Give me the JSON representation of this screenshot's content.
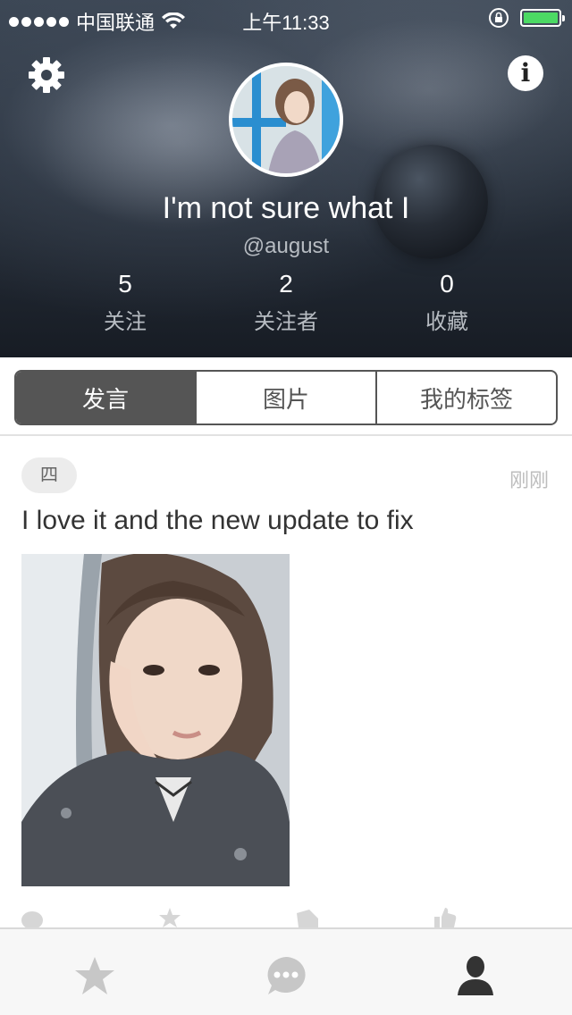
{
  "status_bar": {
    "carrier": "中国联通",
    "time": "上午11:33"
  },
  "profile": {
    "name": "I'm not sure what I",
    "handle": "@august",
    "stats": [
      {
        "value": "5",
        "label": "关注"
      },
      {
        "value": "2",
        "label": "关注者"
      },
      {
        "value": "0",
        "label": "收藏"
      }
    ]
  },
  "header_buttons": {
    "info_glyph": "i"
  },
  "tabs": [
    {
      "label": "发言",
      "active": true
    },
    {
      "label": "图片",
      "active": false
    },
    {
      "label": "我的标签",
      "active": false
    }
  ],
  "post": {
    "badge": "四",
    "time": "刚刚",
    "text": "I love it and the new update to fix"
  },
  "icons": {
    "settings": "gear-icon",
    "info": "info-icon",
    "tabbar": [
      "star-icon",
      "chat-bubble-icon",
      "person-icon"
    ]
  },
  "colors": {
    "battery": "#4cd964",
    "segment_active": "#555555",
    "tab_icon_inactive": "#c7c7c7",
    "tab_icon_active": "#333333"
  }
}
